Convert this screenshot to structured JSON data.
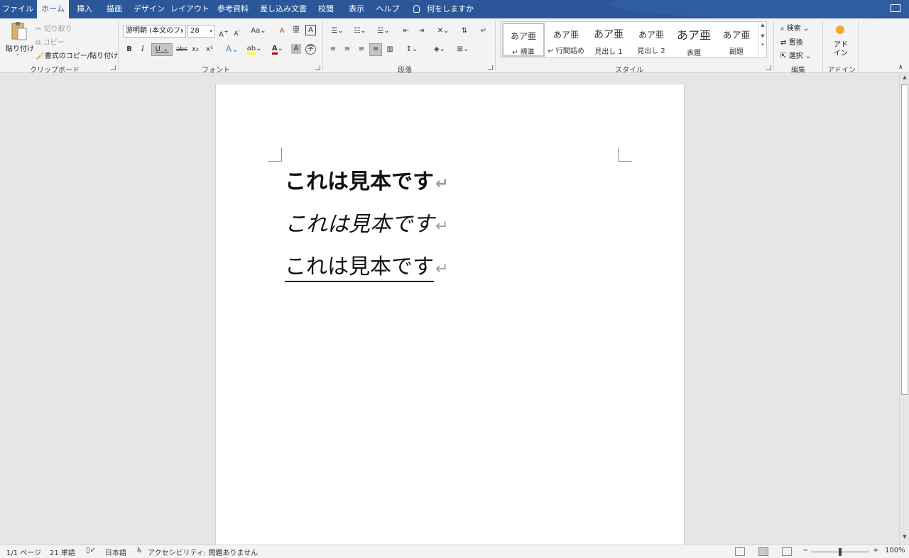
{
  "tabs": [
    "ファイル",
    "ホーム",
    "挿入",
    "描画",
    "デザイン",
    "レイアウト",
    "参考資料",
    "差し込み文書",
    "校閲",
    "表示",
    "ヘルプ"
  ],
  "tell_me": "何をしますか",
  "clipboard": {
    "paste": "貼り付け",
    "cut": "切り取り",
    "copy": "コピー",
    "format_painter": "書式のコピー/貼り付け",
    "label": "クリップボード"
  },
  "font": {
    "name": "游明朝 (本文のフ:",
    "size": "28",
    "label": "フォント",
    "bold": "B",
    "italic": "I",
    "underline": "U",
    "strike": "abc",
    "sub": "x₂",
    "sup": "x²",
    "aa": "Aa"
  },
  "paragraph": {
    "label": "段落"
  },
  "styles": {
    "label": "スタイル",
    "items": [
      {
        "preview": "あア亜",
        "name": "↵ 標準"
      },
      {
        "preview": "あア亜",
        "name": "↵ 行間詰め"
      },
      {
        "preview": "あア亜",
        "name": "見出し 1"
      },
      {
        "preview": "あア亜",
        "name": "見出し 2"
      },
      {
        "preview": "あア亜",
        "name": "表題"
      },
      {
        "preview": "あア亜",
        "name": "副題"
      }
    ]
  },
  "editing": {
    "find": "検索",
    "replace": "置換",
    "select": "選択",
    "label": "編集"
  },
  "addin": {
    "button": "アド\nイン",
    "label": "アドイン"
  },
  "document": {
    "lines": [
      "これは見本です",
      "これは見本です",
      "これは見本です"
    ],
    "para_mark": "↵"
  },
  "status": {
    "page": "1/1 ページ",
    "words": "21 単語",
    "language": "日本語",
    "accessibility": "アクセシビリティ: 問題ありません",
    "zoom": "100%"
  },
  "colors": {
    "accent": "#2b579a",
    "highlight": "#ffff00",
    "font_color": "#c00000"
  }
}
